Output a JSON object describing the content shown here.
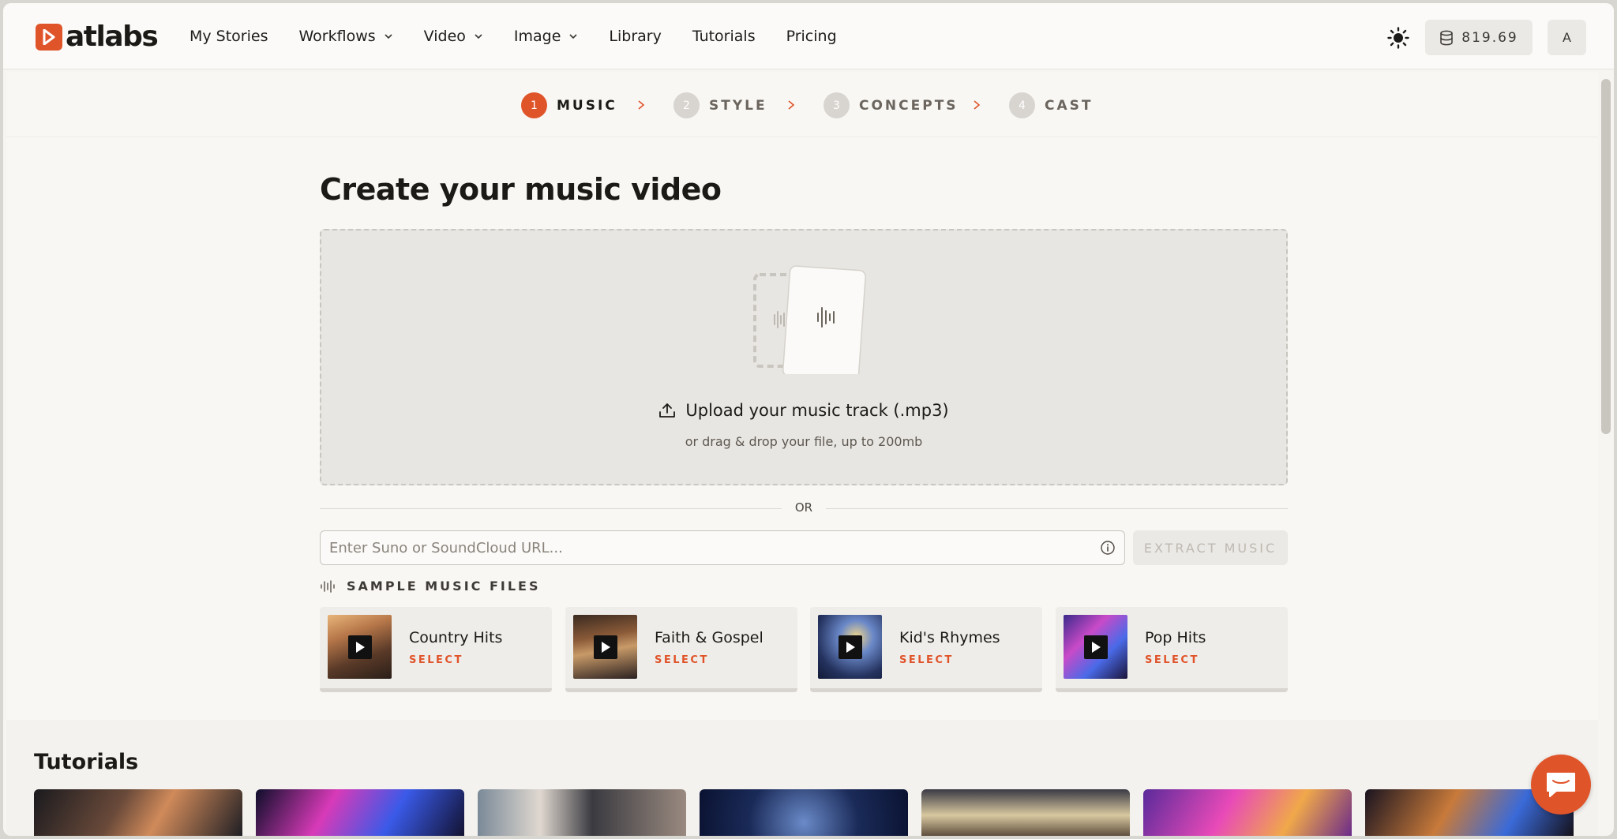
{
  "header": {
    "logo_text": "atlabs",
    "nav": [
      {
        "label": "My Stories",
        "dropdown": false
      },
      {
        "label": "Workflows",
        "dropdown": true
      },
      {
        "label": "Video",
        "dropdown": true
      },
      {
        "label": "Image",
        "dropdown": true
      },
      {
        "label": "Library",
        "dropdown": false
      },
      {
        "label": "Tutorials",
        "dropdown": false
      },
      {
        "label": "Pricing",
        "dropdown": false
      }
    ],
    "credits": "819.69",
    "avatar_initial": "A"
  },
  "stepper": {
    "steps": [
      {
        "num": "1",
        "label": "MUSIC",
        "active": true
      },
      {
        "num": "2",
        "label": "STYLE",
        "active": false
      },
      {
        "num": "3",
        "label": "CONCEPTS",
        "active": false
      },
      {
        "num": "4",
        "label": "CAST",
        "active": false
      }
    ]
  },
  "main": {
    "title": "Create your music video",
    "upload_label": "Upload your music track (.mp3)",
    "upload_sub": "or drag & drop your file, up to 200mb",
    "or_text": "OR",
    "url_placeholder": "Enter Suno or SoundCloud URL...",
    "extract_label": "EXTRACT MUSIC",
    "samples_heading": "SAMPLE MUSIC FILES",
    "samples": [
      {
        "title": "Country Hits",
        "action": "SELECT"
      },
      {
        "title": "Faith & Gospel",
        "action": "SELECT"
      },
      {
        "title": "Kid's Rhymes",
        "action": "SELECT"
      },
      {
        "title": "Pop Hits",
        "action": "SELECT"
      }
    ]
  },
  "tutorials": {
    "title": "Tutorials"
  },
  "colors": {
    "accent": "#e0542a",
    "background": "#f8f7f4",
    "dropzone": "#e8e6e2"
  },
  "icons": {
    "theme": "sun-icon",
    "credits": "database-icon",
    "upload": "upload-icon",
    "info": "info-icon",
    "waveform": "waveform-icon",
    "chat": "chat-icon"
  }
}
